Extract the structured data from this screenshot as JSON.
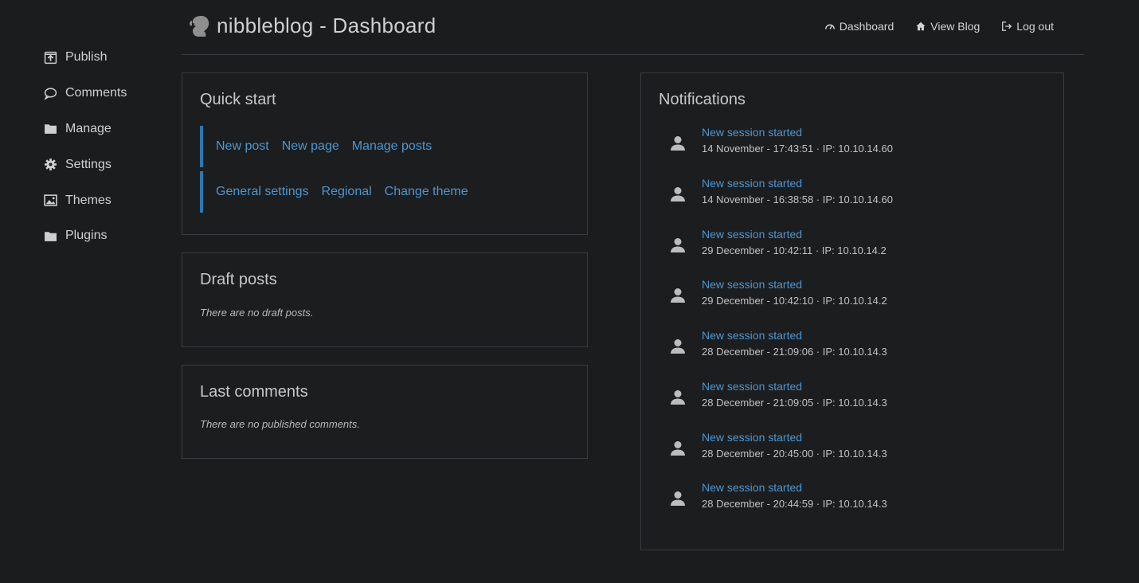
{
  "sidebar": {
    "items": [
      {
        "label": "Publish",
        "icon": "publish-icon"
      },
      {
        "label": "Comments",
        "icon": "comment-icon"
      },
      {
        "label": "Manage",
        "icon": "folder-icon"
      },
      {
        "label": "Settings",
        "icon": "gear-icon"
      },
      {
        "label": "Themes",
        "icon": "image-icon"
      },
      {
        "label": "Plugins",
        "icon": "folder-icon"
      }
    ]
  },
  "header": {
    "title": "nibbleblog - Dashboard",
    "nav": {
      "dashboard": "Dashboard",
      "view_blog": "View Blog",
      "logout": "Log out"
    }
  },
  "quick_start": {
    "title": "Quick start",
    "row1": [
      "New post",
      "New page",
      "Manage posts"
    ],
    "row2": [
      "General settings",
      "Regional",
      "Change theme"
    ]
  },
  "draft_posts": {
    "title": "Draft posts",
    "empty": "There are no draft posts."
  },
  "last_comments": {
    "title": "Last comments",
    "empty": "There are no published comments."
  },
  "notifications": {
    "title": "Notifications",
    "items": [
      {
        "title": "New session started",
        "meta": "14 November - 17:43:51 · IP: 10.10.14.60"
      },
      {
        "title": "New session started",
        "meta": "14 November - 16:38:58 · IP: 10.10.14.60"
      },
      {
        "title": "New session started",
        "meta": "29 December - 10:42:11 · IP: 10.10.14.2"
      },
      {
        "title": "New session started",
        "meta": "29 December - 10:42:10 · IP: 10.10.14.2"
      },
      {
        "title": "New session started",
        "meta": "28 December - 21:09:06 · IP: 10.10.14.3"
      },
      {
        "title": "New session started",
        "meta": "28 December - 21:09:05 · IP: 10.10.14.3"
      },
      {
        "title": "New session started",
        "meta": "28 December - 20:45:00 · IP: 10.10.14.3"
      },
      {
        "title": "New session started",
        "meta": "28 December - 20:44:59 · IP: 10.10.14.3"
      }
    ]
  },
  "colors": {
    "background": "#1b1c1e",
    "link": "#4d96cf",
    "accent_bar": "#2f77b1",
    "border": "#3a3b3e"
  }
}
